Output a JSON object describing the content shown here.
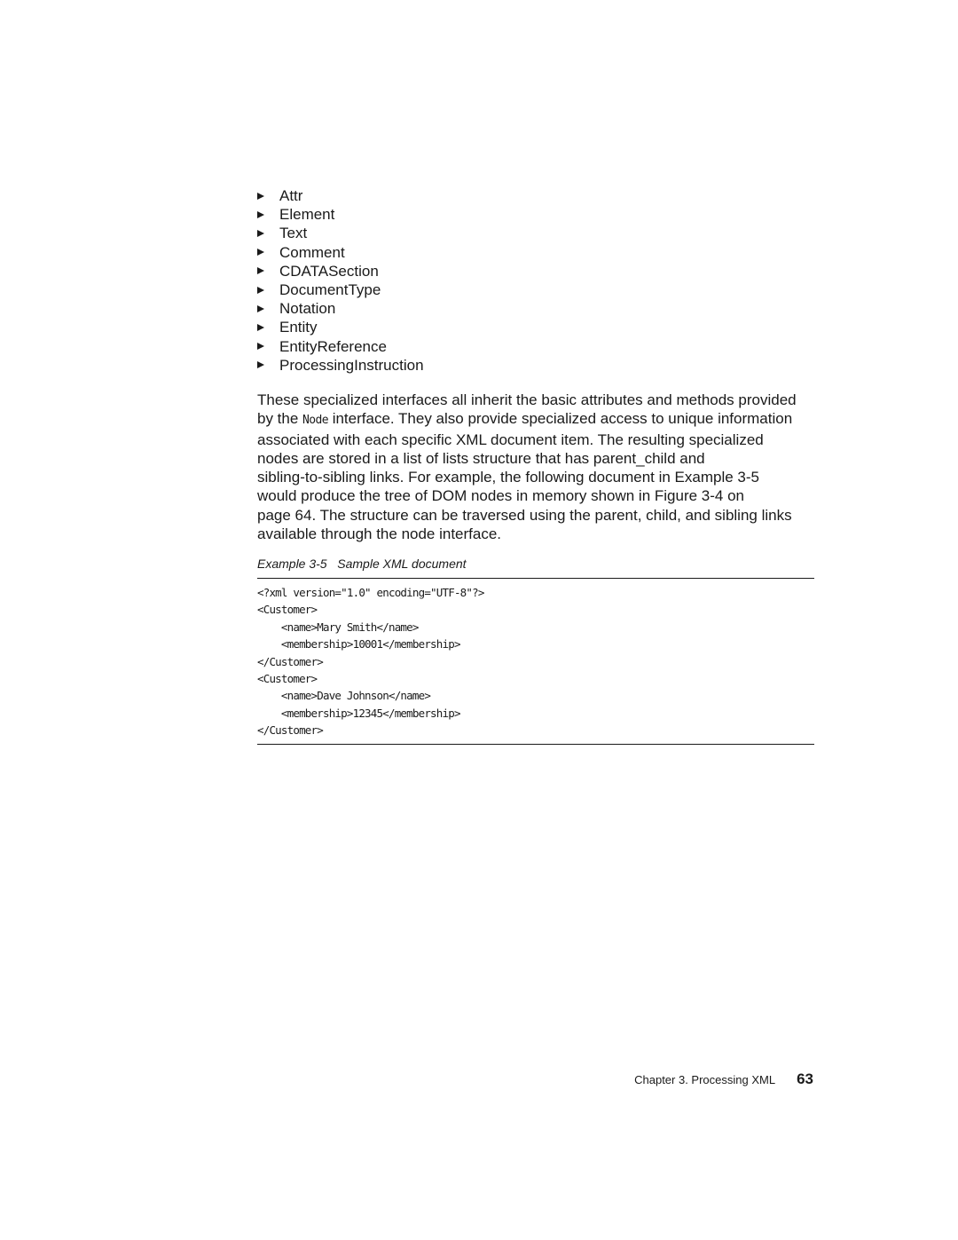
{
  "bullets": [
    "Attr",
    "Element",
    "Text",
    "Comment",
    "CDATASection",
    "DocumentType",
    "Notation",
    "Entity",
    "EntityReference",
    "ProcessingInstruction"
  ],
  "paragraph": {
    "line1": "These specialized interfaces all inherit the basic attributes and methods provided",
    "line2_before_code": "by the ",
    "line2_code": "Node",
    "line2_after_code": " interface. They also provide specialized access to unique information",
    "line3": "associated with each specific XML document item. The resulting specialized",
    "line4": "nodes are stored in a list of lists structure that has parent_child and",
    "line5": "sibling-to-sibling links. For example, the following document in Example 3-5",
    "line6": "would produce the tree of DOM nodes in memory shown in Figure 3-4 on",
    "line7": "page 64. The structure can be traversed using the parent, child, and sibling links",
    "line8": "available through the node interface."
  },
  "example": {
    "caption": "Example 3-5   Sample XML document",
    "code_lines": [
      "<?xml version=\"1.0\" encoding=\"UTF-8\"?>",
      "<Customer>",
      "    <name>Mary Smith</name>",
      "    <membership>10001</membership>",
      "</Customer>",
      "<Customer>",
      "    <name>Dave Johnson</name>",
      "    <membership>12345</membership>",
      "</Customer>"
    ]
  },
  "footer": {
    "chapter": "Chapter 3. Processing XML",
    "page_number": "63"
  }
}
